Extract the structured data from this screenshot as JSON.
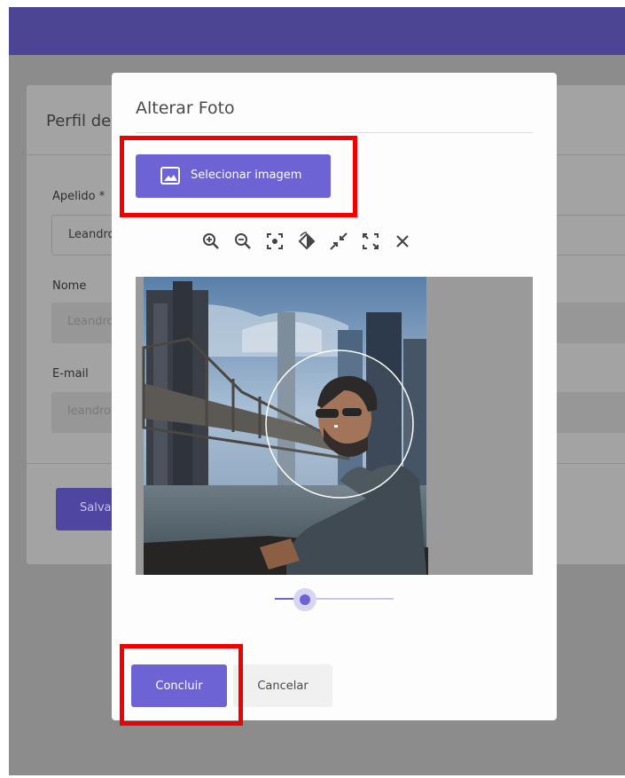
{
  "background_page": {
    "card_title": "Perfil de",
    "fields": [
      {
        "label": "Apelido *",
        "value": "Leandro"
      },
      {
        "label": "Nome",
        "value": "Leandro"
      },
      {
        "label": "E-mail",
        "value": "leandro"
      }
    ],
    "save_label": "Salvar"
  },
  "modal": {
    "title": "Alterar Foto",
    "select_image_label": "Selecionar imagem",
    "tools": [
      "zoom-in-icon",
      "zoom-out-icon",
      "center-focus-icon",
      "rotate-icon",
      "collapse-icon",
      "expand-icon",
      "close-icon"
    ],
    "zoom_level": 0.25,
    "confirm_label": "Concluir",
    "cancel_label": "Cancelar"
  },
  "colors": {
    "header": "#4c4593",
    "primary": "#6d63d4",
    "highlight": "#f20000"
  }
}
